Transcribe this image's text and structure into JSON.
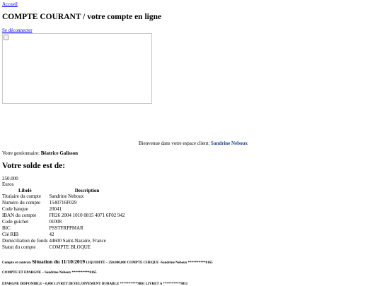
{
  "nav": {
    "home_link": "Accueil",
    "logout_link": "Se déconnecter"
  },
  "header": {
    "title": "COMPTE COURANT / votre compte en ligne"
  },
  "welcome": {
    "prefix": "Bienvenue dans votre espace client:",
    "client_name": "Sandrine Neboux"
  },
  "advisor": {
    "label": "Votre gestionnaire:",
    "name": "Béatrice Galisson"
  },
  "balance": {
    "heading": "Votre solde est de:",
    "amount": "250.000",
    "currency": "Euros"
  },
  "account_table": {
    "headers": [
      "Libelé",
      "Description"
    ],
    "rows": [
      [
        "Titulaire du compte",
        "Sandrine Neboux"
      ],
      [
        "Numéro du compte",
        "1540716F029"
      ],
      [
        "Code banque",
        "20041"
      ],
      [
        "IBAN du compte",
        "FR26 2004 1010 0815 4071 6F02 942"
      ],
      [
        "Code guichet",
        "01008"
      ],
      [
        "BIC",
        "PSSTFRPPMAR"
      ],
      [
        "Clé RIB",
        "42"
      ],
      [
        "Domiciliation de fonds",
        "44600 Saint-Nazaire, France"
      ],
      [
        "Statut du compte",
        "COMPTE BLOQUE"
      ]
    ]
  },
  "situation": {
    "prefix": "Compte et contrats",
    "main": "Situation du 11/10/2019",
    "details": "LIQUIDITÉ – 250.000,00€ COMPTE CHEQUE -Sandrine Neboux **********0165"
  },
  "epargne": {
    "text": "COMPTE ET EPARGNE – Sandrine Neboux **********0165"
  },
  "epargne_dispo": {
    "text": "EPARGNE DISPONIBLE – 0,00€ LIVRET DEVELOPPEMENT DURABLE **********9801 LIVRET A **********9851"
  }
}
